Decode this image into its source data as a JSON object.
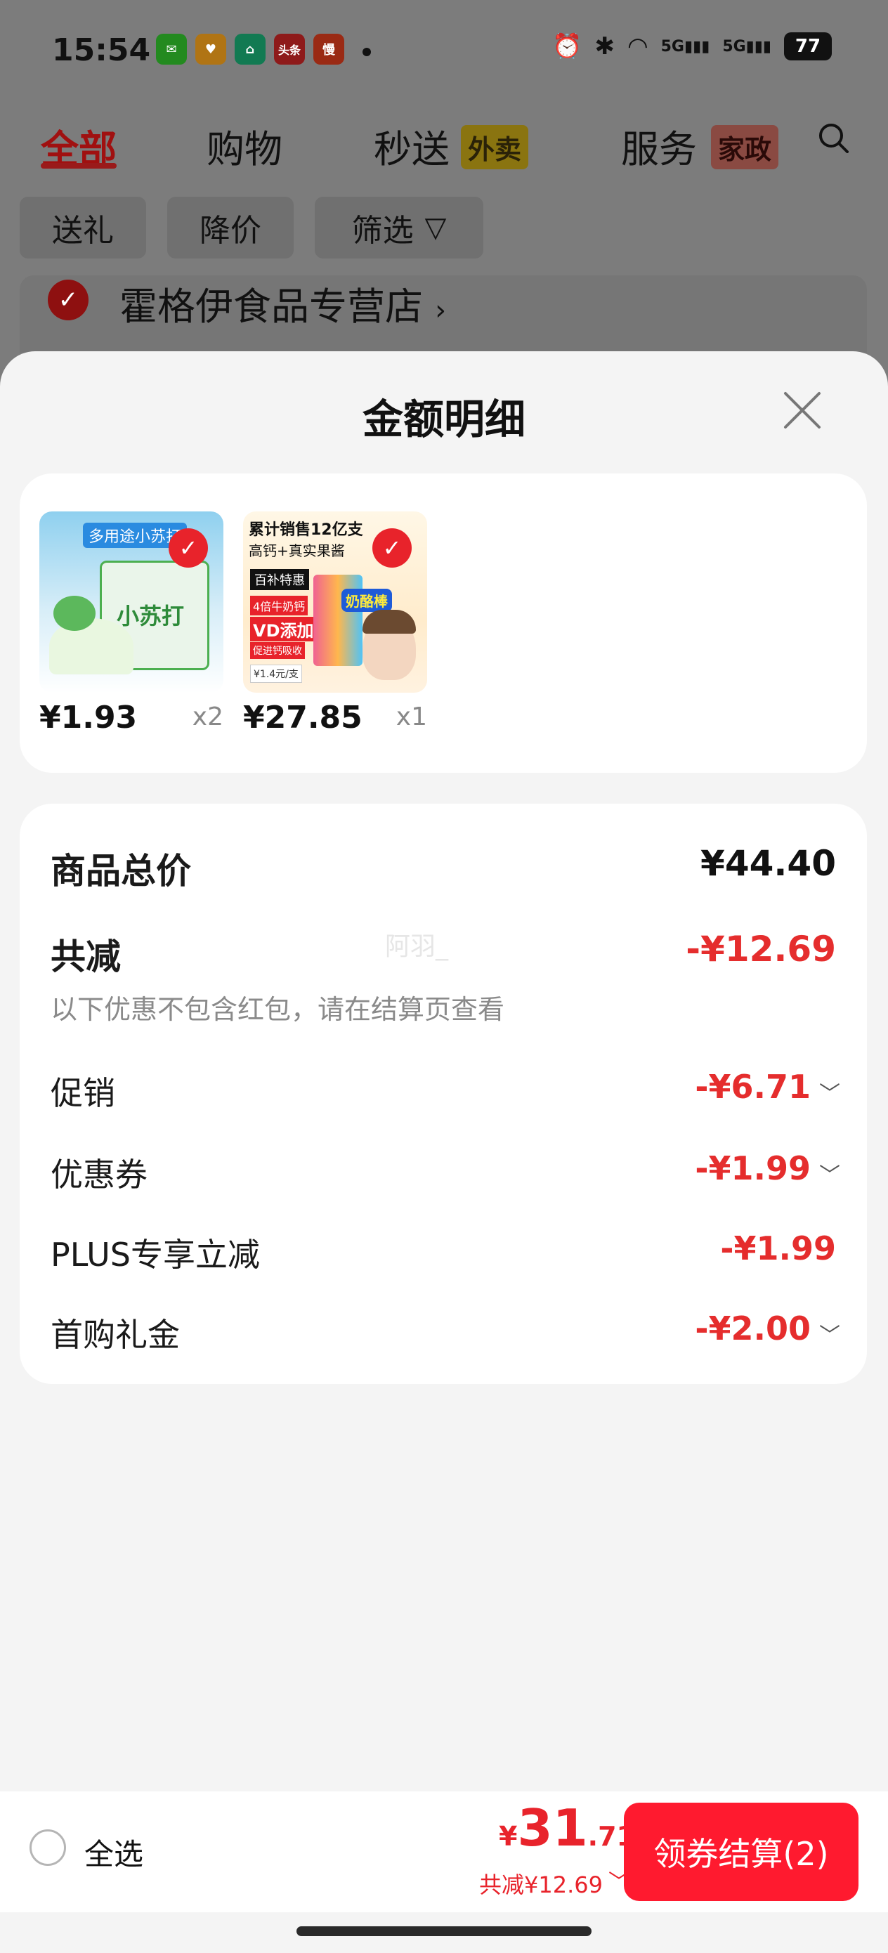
{
  "status_bar": {
    "time": "15:54",
    "app_icons": [
      {
        "name": "wechat-icon",
        "label": "",
        "color": "#2dc100"
      },
      {
        "name": "app-icon-orange",
        "label": "",
        "color": "#f5a623"
      },
      {
        "name": "app-icon-green",
        "label": "",
        "color": "#19c37d"
      },
      {
        "name": "toutiao-icon",
        "label": "头条",
        "color": "#e8232b"
      },
      {
        "name": "app-icon-red",
        "label": "慢",
        "color": "#e8432b"
      }
    ],
    "battery": "77"
  },
  "top_tabs": {
    "all": "全部",
    "shopping": "购物",
    "express": "秒送",
    "express_tag": "外卖",
    "service": "服务",
    "service_tag": "家政"
  },
  "filters": [
    "送礼",
    "降价",
    "筛选"
  ],
  "store": {
    "name": "霍格伊食品专营店",
    "chevron": "›"
  },
  "sheet": {
    "title": "金额明细",
    "products": [
      {
        "name": "baking-soda-product",
        "price": "¥1.93",
        "qty": "x2",
        "img_text": "多用途小苏打",
        "img_text2": "小苏打"
      },
      {
        "name": "kids-stick-product",
        "price": "¥27.85",
        "qty": "x1",
        "img_text": "累计销售12亿支",
        "img_text2": "高钙+真实果酱",
        "img_text3": "百补特惠",
        "img_text4": "4倍牛奶钙",
        "img_text5": "VD添加",
        "img_text6": "促进钙吸收",
        "img_text7": "¥1.4元/支",
        "img_text8": "奶酪棒"
      }
    ],
    "summary": {
      "total_label": "商品总价",
      "total_value": "¥44.40",
      "reduce_label": "共减",
      "reduce_value": "-¥12.69",
      "note": "以下优惠不包含红包，请在结算页查看",
      "items": [
        {
          "label": "促销",
          "value": "-¥6.71",
          "chevron": "﹀"
        },
        {
          "label": "优惠券",
          "value": "-¥1.99",
          "chevron": "﹀"
        },
        {
          "label": "PLUS专享立减",
          "value": "-¥1.99",
          "chevron": ""
        },
        {
          "label": "首购礼金",
          "value": "-¥2.00",
          "chevron": "﹀"
        }
      ],
      "watermark": "阿羽_"
    }
  },
  "bottom_bar": {
    "select_all": "全选",
    "currency": "¥",
    "total_int": "31",
    "total_dec": ".71",
    "saving": "共减¥12.69",
    "saving_chevron": "﹀",
    "checkout": "领券结算(2)"
  }
}
